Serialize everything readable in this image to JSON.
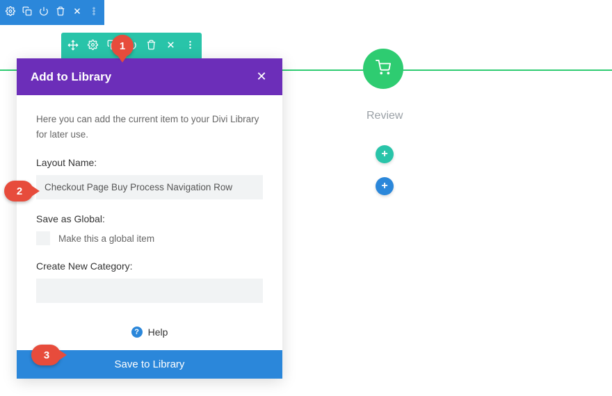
{
  "review_label": "Review",
  "modal": {
    "title": "Add to Library",
    "description": "Here you can add the current item to your Divi Library for later use.",
    "layout_name_label": "Layout Name:",
    "layout_name_value": "Checkout Page Buy Process Navigation Row",
    "save_global_label": "Save as Global:",
    "global_checkbox_label": "Make this a global item",
    "create_category_label": "Create New Category:",
    "create_category_value": "",
    "help_label": "Help",
    "submit_label": "Save to Library"
  },
  "callouts": {
    "c1": "1",
    "c2": "2",
    "c3": "3"
  }
}
